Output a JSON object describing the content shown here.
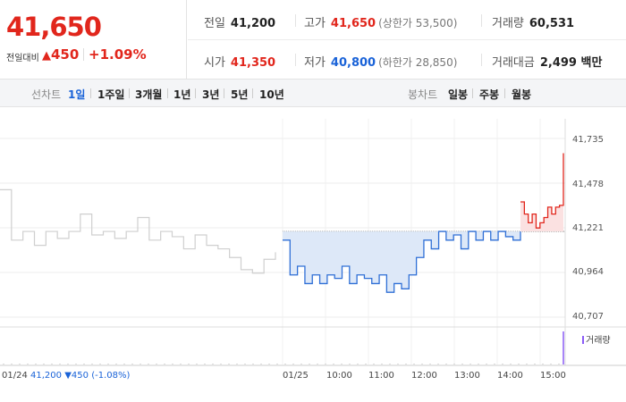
{
  "quote": {
    "price": "41,650",
    "change_label": "전일대비",
    "change_triangle": "▲",
    "change_amount": "450",
    "change_pct": "+1.09%"
  },
  "stats": {
    "prev_close_label": "전일",
    "prev_close": "41,200",
    "high_label": "고가",
    "high": "41,650",
    "upper_limit": "(상한가 53,500)",
    "volume_label": "거래량",
    "volume": "60,531",
    "open_label": "시가",
    "open": "41,350",
    "low_label": "저가",
    "low": "40,800",
    "lower_limit": "(하한가 28,850)",
    "turnover_label": "거래대금",
    "turnover": "2,499 백만"
  },
  "tabs": {
    "line_label": "선차트",
    "line": [
      "1일",
      "1주일",
      "3개월",
      "1년",
      "3년",
      "5년",
      "10년"
    ],
    "selected": "1일",
    "candle_label": "봉차트",
    "candle": [
      "일봉",
      "주봉",
      "월봉"
    ]
  },
  "chart": {
    "y_ticks": [
      "41,735",
      "41,478",
      "41,221",
      "40,964",
      "40,707"
    ],
    "x_ticks": [
      "01/25",
      "10:00",
      "11:00",
      "12:00",
      "13:00",
      "14:00",
      "15:00"
    ],
    "volume_legend": "거래량",
    "prev_day_info": {
      "date": "01/24",
      "price": "41,200",
      "arrow": "▼",
      "change": "450",
      "pct": "(-1.08%)"
    }
  },
  "chart_data": {
    "type": "line",
    "ylim": [
      40707,
      41735
    ],
    "reference_price": 41200,
    "series": [
      {
        "x": [
          "01/24",
          "01/24",
          "01/24",
          "01/24",
          "01/24",
          "01/24",
          "01/24",
          "01/24",
          "01/24",
          "01/24",
          "01/24",
          "01/24",
          "01/24",
          "01/24",
          "01/24",
          "01/24",
          "01/24",
          "01/24",
          "01/24",
          "01/24",
          "01/24",
          "01/24",
          "01/24",
          "01/24",
          "01/24"
        ],
        "values": [
          41440,
          41150,
          41200,
          41120,
          41200,
          41160,
          41200,
          41300,
          41180,
          41200,
          41160,
          41200,
          41280,
          41150,
          41200,
          41170,
          41100,
          41180,
          41120,
          41100,
          41050,
          40980,
          40960,
          41040,
          41080
        ]
      },
      {
        "x": [
          "09:00",
          "09:10",
          "09:20",
          "09:30",
          "09:40",
          "09:50",
          "10:00",
          "10:10",
          "10:20",
          "10:30",
          "10:40",
          "10:50",
          "11:00",
          "11:10",
          "11:20",
          "11:30",
          "11:40",
          "11:50",
          "12:00",
          "12:10",
          "12:20",
          "12:30",
          "12:40",
          "12:50",
          "13:00",
          "13:10",
          "13:20",
          "13:30",
          "13:40",
          "13:50",
          "14:00",
          "14:10",
          "14:20"
        ],
        "values": [
          41150,
          40950,
          41000,
          40900,
          40950,
          40900,
          40950,
          40930,
          41000,
          40900,
          40950,
          40930,
          40900,
          40950,
          40850,
          40900,
          40870,
          40950,
          41050,
          41150,
          41100,
          41200,
          41150,
          41180,
          41100,
          41200,
          41150,
          41200,
          41150,
          41200,
          41170,
          41150,
          41200
        ]
      },
      {
        "x": [
          "14:30",
          "14:35",
          "14:40",
          "14:45",
          "14:50",
          "14:55",
          "15:00",
          "15:05",
          "15:10",
          "15:15",
          "15:20",
          "15:30"
        ],
        "values": [
          41370,
          41300,
          41250,
          41300,
          41220,
          41250,
          41280,
          41340,
          41300,
          41340,
          41350,
          41650
        ]
      }
    ]
  }
}
